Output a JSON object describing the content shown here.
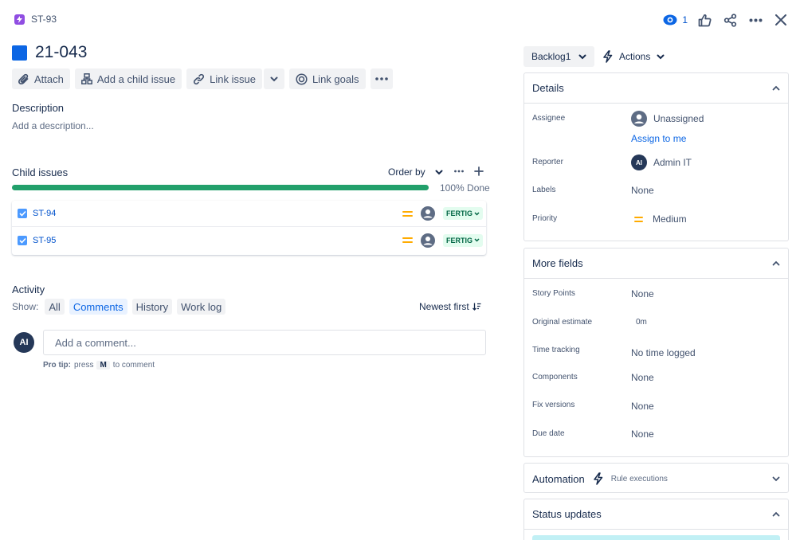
{
  "breadcrumb": {
    "key": "ST-93"
  },
  "top_actions": {
    "watch_count": "1"
  },
  "issue": {
    "title": "21-043"
  },
  "toolbar": {
    "attach": "Attach",
    "add_child": "Add a child issue",
    "link_issue": "Link issue",
    "link_goals": "Link goals"
  },
  "description": {
    "label": "Description",
    "placeholder": "Add a description..."
  },
  "child_issues": {
    "label": "Child issues",
    "order_by": "Order by",
    "progress_percent": 100,
    "progress_text": "100% Done",
    "items": [
      {
        "key": "ST-94",
        "status": "FERTIG"
      },
      {
        "key": "ST-95",
        "status": "FERTIG"
      }
    ]
  },
  "activity": {
    "label": "Activity",
    "show_label": "Show:",
    "tabs": [
      "All",
      "Comments",
      "History",
      "Work log"
    ],
    "active_tab": "Comments",
    "sort": "Newest first",
    "avatar_initials": "AI",
    "comment_placeholder": "Add a comment...",
    "pro_tip_bold": "Pro tip:",
    "pro_tip_press": "press",
    "pro_tip_key": "M",
    "pro_tip_rest": "to comment"
  },
  "sidebar": {
    "status_button": "Backlog1",
    "actions_button": "Actions",
    "details": {
      "title": "Details",
      "assignee_label": "Assignee",
      "assignee_value": "Unassigned",
      "assign_to_me": "Assign to me",
      "reporter_label": "Reporter",
      "reporter_initials": "AI",
      "reporter_value": "Admin IT",
      "labels_label": "Labels",
      "labels_value": "None",
      "priority_label": "Priority",
      "priority_value": "Medium"
    },
    "more_fields": {
      "title": "More fields",
      "story_points_label": "Story Points",
      "story_points_value": "None",
      "original_estimate_label": "Original estimate",
      "original_estimate_value": "0m",
      "time_tracking_label": "Time tracking",
      "time_tracking_value": "No time logged",
      "components_label": "Components",
      "components_value": "None",
      "fix_versions_label": "Fix versions",
      "fix_versions_value": "None",
      "due_date_label": "Due date",
      "due_date_value": "None"
    },
    "automation": {
      "title": "Automation",
      "subtitle": "Rule executions"
    },
    "status_updates": {
      "title": "Status updates"
    }
  },
  "colors": {
    "accent": "#0c66e4",
    "progress": "#22a06b",
    "status_done_bg": "#e3fcef",
    "status_done_text": "#006644",
    "priority_medium": "#ffab00"
  }
}
